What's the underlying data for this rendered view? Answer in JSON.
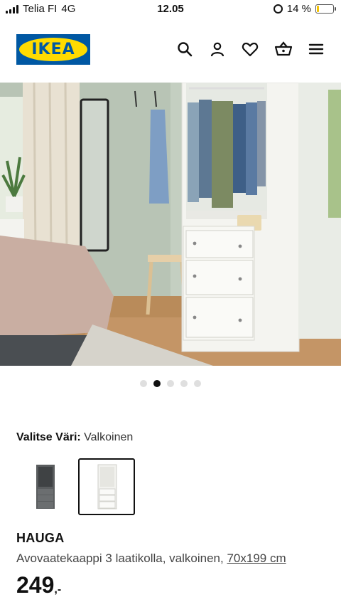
{
  "status_bar": {
    "carrier": "Telia FI",
    "network": "4G",
    "time": "12.05",
    "battery_percent": "14 %",
    "battery_level": 0.14
  },
  "header": {
    "logo_text": "IKEA",
    "icons": [
      "search-icon",
      "user-icon",
      "heart-icon",
      "basket-icon",
      "menu-icon"
    ]
  },
  "carousel": {
    "count": 5,
    "active_index": 1
  },
  "variant": {
    "label": "Valitse Väri:",
    "value": "Valkoinen",
    "options": [
      "gray-wardrobe",
      "white-wardrobe"
    ],
    "selected": 1
  },
  "product": {
    "name": "HAUGA",
    "description": "Avovaatekaappi 3 laatikolla, valkoinen,",
    "size": "70x199 cm",
    "price": "249",
    "price_suffix": ",-"
  },
  "colors": {
    "ikea_blue": "#0058a3",
    "ikea_yellow": "#ffdb00",
    "battery": "#f5c400"
  }
}
